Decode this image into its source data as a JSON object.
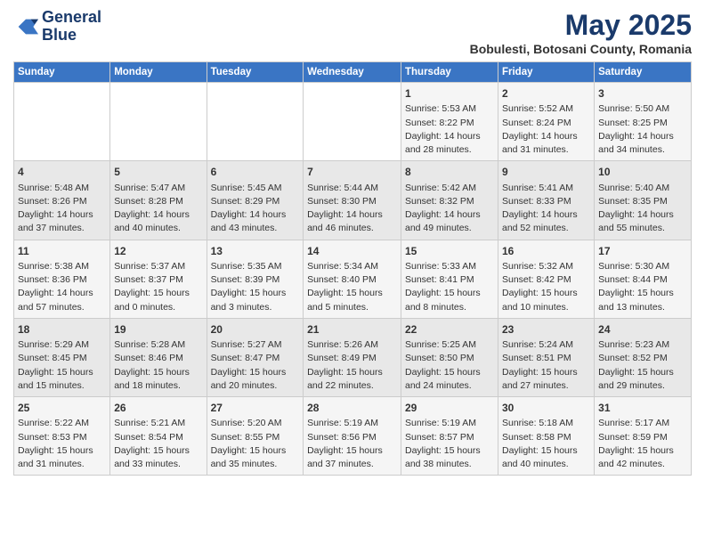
{
  "header": {
    "logo_line1": "General",
    "logo_line2": "Blue",
    "month": "May 2025",
    "location": "Bobulesti, Botosani County, Romania"
  },
  "days_of_week": [
    "Sunday",
    "Monday",
    "Tuesday",
    "Wednesday",
    "Thursday",
    "Friday",
    "Saturday"
  ],
  "weeks": [
    [
      {
        "day": "",
        "info": ""
      },
      {
        "day": "",
        "info": ""
      },
      {
        "day": "",
        "info": ""
      },
      {
        "day": "",
        "info": ""
      },
      {
        "day": "1",
        "info": "Sunrise: 5:53 AM\nSunset: 8:22 PM\nDaylight: 14 hours\nand 28 minutes."
      },
      {
        "day": "2",
        "info": "Sunrise: 5:52 AM\nSunset: 8:24 PM\nDaylight: 14 hours\nand 31 minutes."
      },
      {
        "day": "3",
        "info": "Sunrise: 5:50 AM\nSunset: 8:25 PM\nDaylight: 14 hours\nand 34 minutes."
      }
    ],
    [
      {
        "day": "4",
        "info": "Sunrise: 5:48 AM\nSunset: 8:26 PM\nDaylight: 14 hours\nand 37 minutes."
      },
      {
        "day": "5",
        "info": "Sunrise: 5:47 AM\nSunset: 8:28 PM\nDaylight: 14 hours\nand 40 minutes."
      },
      {
        "day": "6",
        "info": "Sunrise: 5:45 AM\nSunset: 8:29 PM\nDaylight: 14 hours\nand 43 minutes."
      },
      {
        "day": "7",
        "info": "Sunrise: 5:44 AM\nSunset: 8:30 PM\nDaylight: 14 hours\nand 46 minutes."
      },
      {
        "day": "8",
        "info": "Sunrise: 5:42 AM\nSunset: 8:32 PM\nDaylight: 14 hours\nand 49 minutes."
      },
      {
        "day": "9",
        "info": "Sunrise: 5:41 AM\nSunset: 8:33 PM\nDaylight: 14 hours\nand 52 minutes."
      },
      {
        "day": "10",
        "info": "Sunrise: 5:40 AM\nSunset: 8:35 PM\nDaylight: 14 hours\nand 55 minutes."
      }
    ],
    [
      {
        "day": "11",
        "info": "Sunrise: 5:38 AM\nSunset: 8:36 PM\nDaylight: 14 hours\nand 57 minutes."
      },
      {
        "day": "12",
        "info": "Sunrise: 5:37 AM\nSunset: 8:37 PM\nDaylight: 15 hours\nand 0 minutes."
      },
      {
        "day": "13",
        "info": "Sunrise: 5:35 AM\nSunset: 8:39 PM\nDaylight: 15 hours\nand 3 minutes."
      },
      {
        "day": "14",
        "info": "Sunrise: 5:34 AM\nSunset: 8:40 PM\nDaylight: 15 hours\nand 5 minutes."
      },
      {
        "day": "15",
        "info": "Sunrise: 5:33 AM\nSunset: 8:41 PM\nDaylight: 15 hours\nand 8 minutes."
      },
      {
        "day": "16",
        "info": "Sunrise: 5:32 AM\nSunset: 8:42 PM\nDaylight: 15 hours\nand 10 minutes."
      },
      {
        "day": "17",
        "info": "Sunrise: 5:30 AM\nSunset: 8:44 PM\nDaylight: 15 hours\nand 13 minutes."
      }
    ],
    [
      {
        "day": "18",
        "info": "Sunrise: 5:29 AM\nSunset: 8:45 PM\nDaylight: 15 hours\nand 15 minutes."
      },
      {
        "day": "19",
        "info": "Sunrise: 5:28 AM\nSunset: 8:46 PM\nDaylight: 15 hours\nand 18 minutes."
      },
      {
        "day": "20",
        "info": "Sunrise: 5:27 AM\nSunset: 8:47 PM\nDaylight: 15 hours\nand 20 minutes."
      },
      {
        "day": "21",
        "info": "Sunrise: 5:26 AM\nSunset: 8:49 PM\nDaylight: 15 hours\nand 22 minutes."
      },
      {
        "day": "22",
        "info": "Sunrise: 5:25 AM\nSunset: 8:50 PM\nDaylight: 15 hours\nand 24 minutes."
      },
      {
        "day": "23",
        "info": "Sunrise: 5:24 AM\nSunset: 8:51 PM\nDaylight: 15 hours\nand 27 minutes."
      },
      {
        "day": "24",
        "info": "Sunrise: 5:23 AM\nSunset: 8:52 PM\nDaylight: 15 hours\nand 29 minutes."
      }
    ],
    [
      {
        "day": "25",
        "info": "Sunrise: 5:22 AM\nSunset: 8:53 PM\nDaylight: 15 hours\nand 31 minutes."
      },
      {
        "day": "26",
        "info": "Sunrise: 5:21 AM\nSunset: 8:54 PM\nDaylight: 15 hours\nand 33 minutes."
      },
      {
        "day": "27",
        "info": "Sunrise: 5:20 AM\nSunset: 8:55 PM\nDaylight: 15 hours\nand 35 minutes."
      },
      {
        "day": "28",
        "info": "Sunrise: 5:19 AM\nSunset: 8:56 PM\nDaylight: 15 hours\nand 37 minutes."
      },
      {
        "day": "29",
        "info": "Sunrise: 5:19 AM\nSunset: 8:57 PM\nDaylight: 15 hours\nand 38 minutes."
      },
      {
        "day": "30",
        "info": "Sunrise: 5:18 AM\nSunset: 8:58 PM\nDaylight: 15 hours\nand 40 minutes."
      },
      {
        "day": "31",
        "info": "Sunrise: 5:17 AM\nSunset: 8:59 PM\nDaylight: 15 hours\nand 42 minutes."
      }
    ]
  ]
}
